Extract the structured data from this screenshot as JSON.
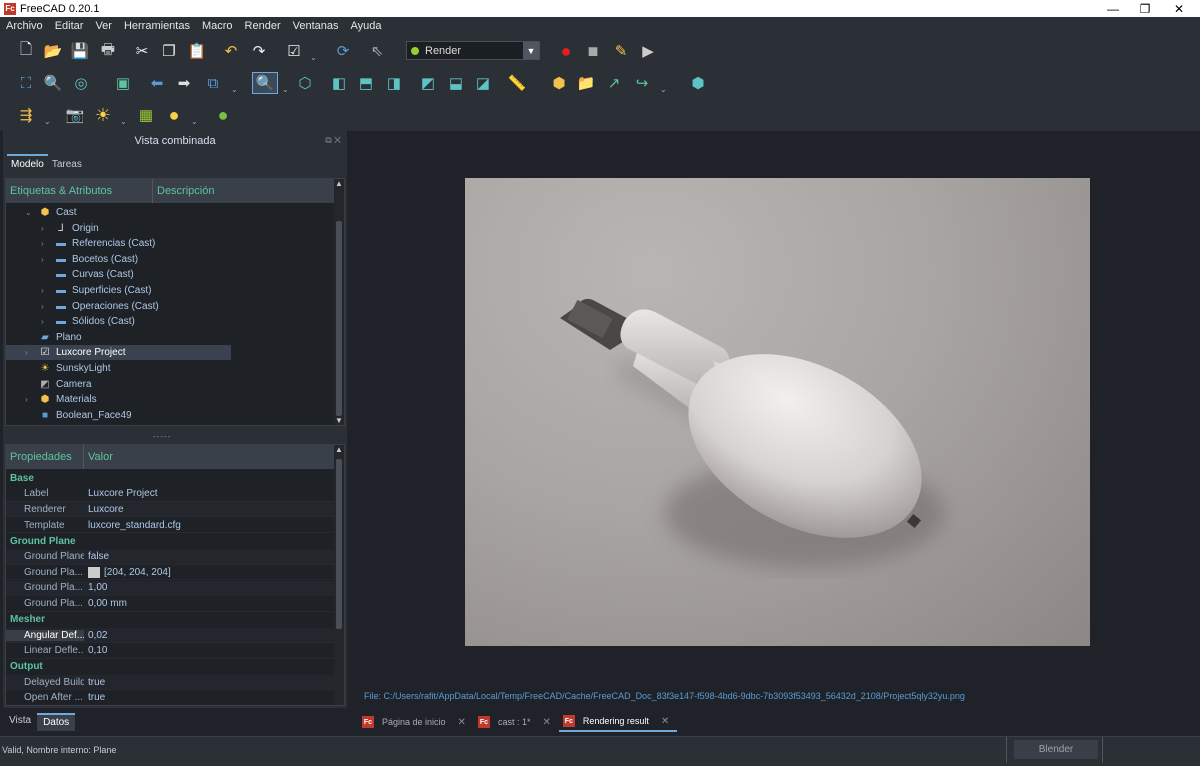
{
  "window": {
    "title": "FreeCAD 0.20.1",
    "logo_text": "Fc",
    "controls": {
      "minimize": "—",
      "maximize": "❐",
      "close": "✕"
    }
  },
  "menu": [
    "Archivo",
    "Editar",
    "Ver",
    "Herramientas",
    "Macro",
    "Render",
    "Ventanas",
    "Ayuda"
  ],
  "toolbar": {
    "workbench_selector": "Render",
    "icons_row1": [
      "new-file-icon",
      "open-file-icon",
      "save-icon",
      "print-icon",
      "cut-icon",
      "copy-icon",
      "paste-icon",
      "undo-icon",
      "redo-icon",
      "refresh-check-icon",
      "recompute-icon",
      "whats-this-icon",
      "record-macro-icon",
      "stop-macro-icon",
      "edit-macro-icon",
      "run-macro-icon"
    ],
    "icons_row2": [
      "fit-all-icon",
      "fit-selection-icon",
      "draw-style-icon",
      "bounding-box-icon",
      "back-icon",
      "forward-icon",
      "sync-view-icon",
      "std-view-menu-icon",
      "isometric-view-icon",
      "front-view-icon",
      "top-view-icon",
      "right-view-icon",
      "rear-view-icon",
      "bottom-view-icon",
      "left-view-icon",
      "measure-icon",
      "part-icon",
      "group-icon",
      "link-icon",
      "link-actions-icon",
      "workbench-icon"
    ],
    "icons_row3": [
      "render-project-icon",
      "camera-icon",
      "sun-light-icon",
      "image-light-icon",
      "material-icon",
      "render-icon"
    ]
  },
  "combo_view": {
    "title": "Vista combinada",
    "tabs": [
      "Modelo",
      "Tareas"
    ],
    "active_tab": "Modelo",
    "tree_headers": [
      "Etiquetas & Atributos",
      "Descripción"
    ],
    "tree_items": [
      {
        "label": "Cast",
        "icon": "body-icon",
        "level": 1,
        "expander": "⌄"
      },
      {
        "label": "Origin",
        "icon": "origin-icon",
        "level": 2,
        "expander": "›"
      },
      {
        "label": "Referencias (Cast)",
        "icon": "folder-icon",
        "level": 2,
        "expander": "›"
      },
      {
        "label": "Bocetos (Cast)",
        "icon": "folder-icon",
        "level": 2,
        "expander": "›"
      },
      {
        "label": "Curvas (Cast)",
        "icon": "folder-icon",
        "level": 2,
        "expander": ""
      },
      {
        "label": "Superficies (Cast)",
        "icon": "folder-icon",
        "level": 2,
        "expander": "›"
      },
      {
        "label": "Operaciones (Cast)",
        "icon": "folder-icon",
        "level": 2,
        "expander": "›"
      },
      {
        "label": "Sólidos (Cast)",
        "icon": "folder-icon",
        "level": 2,
        "expander": "›"
      },
      {
        "label": "Plano",
        "icon": "plane-icon",
        "level": 1,
        "expander": ""
      },
      {
        "label": "Luxcore Project",
        "icon": "render-project-icon",
        "level": 1,
        "expander": "›",
        "selected": true
      },
      {
        "label": "SunskyLight",
        "icon": "sun-icon",
        "level": 1,
        "expander": ""
      },
      {
        "label": "Camera",
        "icon": "camera-icon",
        "level": 1,
        "expander": ""
      },
      {
        "label": "Materials",
        "icon": "materials-icon",
        "level": 1,
        "expander": "›"
      },
      {
        "label": "Boolean_Face49",
        "icon": "solid-icon",
        "level": 1,
        "expander": ""
      }
    ],
    "splitter_handle": "-----"
  },
  "properties": {
    "headers": [
      "Propiedades",
      "Valor"
    ],
    "groups": [
      {
        "name": "Base",
        "rows": [
          {
            "name": "Label",
            "value": "Luxcore Project"
          },
          {
            "name": "Renderer",
            "value": "Luxcore"
          },
          {
            "name": "Template",
            "value": "luxcore_standard.cfg"
          }
        ]
      },
      {
        "name": "Ground Plane",
        "rows": [
          {
            "name": "Ground Plane",
            "value": "false"
          },
          {
            "name": "Ground Pla...",
            "value": "[204, 204, 204]",
            "swatch": "#cccccc"
          },
          {
            "name": "Ground Pla...",
            "value": "1,00"
          },
          {
            "name": "Ground Pla...",
            "value": "0,00 mm"
          }
        ]
      },
      {
        "name": "Mesher",
        "rows": [
          {
            "name": "Angular Def...",
            "value": "0,02"
          },
          {
            "name": "Linear Defle...",
            "value": "0,10"
          }
        ]
      },
      {
        "name": "Output",
        "rows": [
          {
            "name": "Delayed Build",
            "value": "true"
          },
          {
            "name": "Open After ...",
            "value": "true"
          }
        ]
      }
    ]
  },
  "bottom_tabs": [
    "Vista",
    "Datos"
  ],
  "bottom_active": "Datos",
  "main": {
    "file_path": "File: C:/Users/rafit/AppData/Local/Temp/FreeCAD/Cache/FreeCAD_Doc_83f3e147-f598-4bd6-9dbc-7b3093f53493_56432d_2108/Project5qly32yu.png",
    "doc_tabs": [
      {
        "label": "Página de inicio",
        "close": "✕"
      },
      {
        "label": "cast : 1*",
        "close": "✕"
      },
      {
        "label": "Rendering result",
        "close": "✕",
        "active": true
      }
    ]
  },
  "status": {
    "text": "Valid, Nombre interno: Plane",
    "right_button": "Blender"
  },
  "colors": {
    "accent": "#6fa8dc",
    "tree_header": "#5ec3a0",
    "link_text": "#5b9bd5",
    "brand": "#c0392b"
  }
}
